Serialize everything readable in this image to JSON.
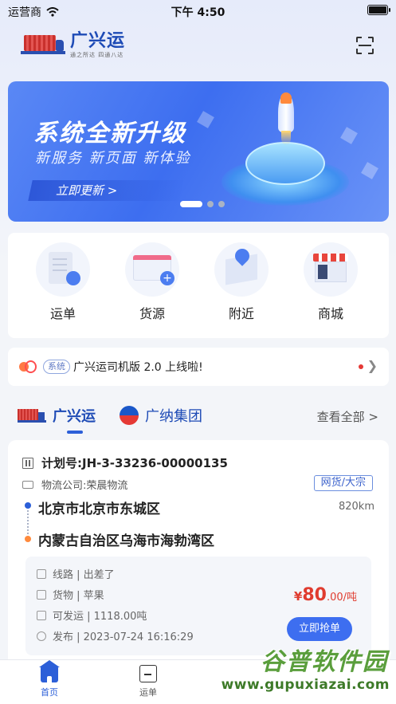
{
  "status_bar": {
    "carrier": "运营商",
    "time": "下午 4:50"
  },
  "header": {
    "brand": "广兴运",
    "slogan": "通之所达 四通八达"
  },
  "banner": {
    "title": "系统全新升级",
    "subtitle": "新服务 新页面 新体验",
    "button": "立即更新  >",
    "page_count": 3,
    "active_page": 1
  },
  "quick_menu": [
    {
      "label": "运单",
      "icon": "waybill-icon"
    },
    {
      "label": "货源",
      "icon": "cargo-source-icon"
    },
    {
      "label": "附近",
      "icon": "nearby-map-icon"
    },
    {
      "label": "商城",
      "icon": "shop-icon"
    }
  ],
  "notice": {
    "tag": "系统",
    "text": "广兴运司机版 2.0 上线啦!"
  },
  "company_tabs": {
    "tab1": "广兴运",
    "tab2": "广纳集团",
    "view_all": "查看全部 >"
  },
  "order": {
    "plan_no": "计划号:JH-3-33236-00000135",
    "logistics": "物流公司:荣晨物流",
    "freight_tag": "网货/大宗",
    "from": "北京市北京市东城区",
    "to": "内蒙古自治区乌海市海勃湾区",
    "distance": "820km",
    "route": "线路 | 出差了",
    "goods": "货物 | 苹果",
    "available": "可发运 | 1118.00吨",
    "published": "发布 | 2023-07-24 16:16:29",
    "price_currency": "¥",
    "price_int": "80",
    "price_unit": ".00/吨",
    "grab_button": "立即抢单"
  },
  "tabbar": {
    "home": "首页",
    "waybill": "运单"
  },
  "watermark": {
    "cn": "谷普软件园",
    "url": "www.gupuxiazai.com"
  },
  "colors": {
    "primary": "#3d6ef0",
    "price": "#e03c2f",
    "brand": "#1e4bb6"
  }
}
